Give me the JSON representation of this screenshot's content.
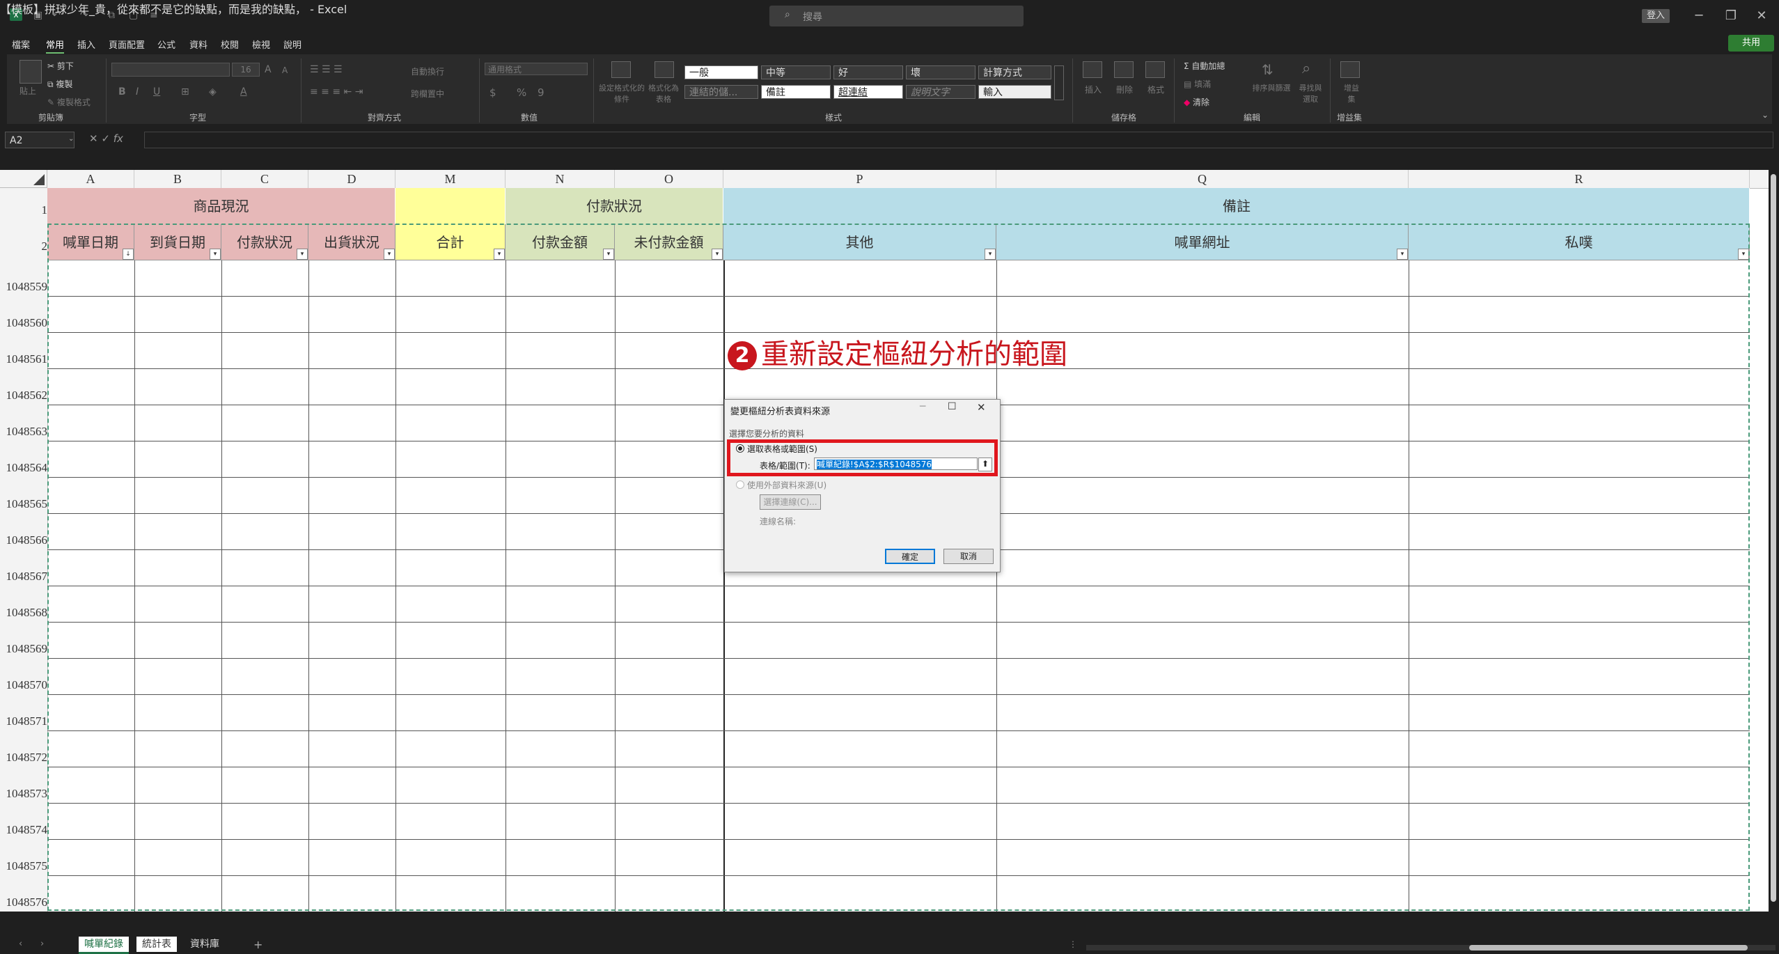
{
  "window": {
    "title": "【模板】拼球少年_貴，從來都不是它的缺點，而是我的缺點， - Excel",
    "search_placeholder": "搜尋",
    "signin": "登入",
    "minimize": "─",
    "restore": "❐",
    "close": "✕"
  },
  "menu": {
    "tabs": [
      "檔案",
      "常用",
      "插入",
      "頁面配置",
      "公式",
      "資料",
      "校閱",
      "檢視",
      "說明"
    ],
    "share": "共用"
  },
  "ribbon": {
    "clipboard": {
      "paste": "貼上",
      "cut": "剪下",
      "copy": "複製",
      "format_painter": "複製格式",
      "label": "剪貼簿"
    },
    "font": {
      "label": "字型",
      "size": "16",
      "bold": "B",
      "italic": "I",
      "underline": "U",
      "grow": "A",
      "shrink": "A"
    },
    "alignment": {
      "wrap": "自動換行",
      "merge": "跨欄置中",
      "label": "對齊方式"
    },
    "number": {
      "format": "通用格式",
      "currency": "$",
      "percent": "%",
      "comma": "9",
      "label": "數值"
    },
    "styles": {
      "conditional": "設定格式化的條件",
      "format_table": "格式化為表格",
      "cells": [
        "一般",
        "中等",
        "好",
        "壞",
        "計算方式",
        "連結的儲...",
        "備註",
        "超連結",
        "說明文字",
        "輸入"
      ],
      "label": "樣式"
    },
    "cells_group": {
      "insert": "插入",
      "delete": "刪除",
      "format": "格式",
      "label": "儲存格"
    },
    "editing": {
      "autosum": "自動加總",
      "fill": "填滿",
      "clear": "清除",
      "sort": "排序與篩選",
      "find": "尋找與選取",
      "label": "編輯"
    },
    "addins": {
      "addins": "增益集",
      "label": "增益集"
    }
  },
  "formula_bar": {
    "name_box": "A2",
    "fx": "fx"
  },
  "sheet": {
    "columns": [
      "A",
      "B",
      "C",
      "D",
      "M",
      "N",
      "O",
      "P",
      "Q",
      "R"
    ],
    "row1_headers": [
      "1",
      "2"
    ],
    "header_row1": [
      "商品現況",
      "付款狀況",
      "備註"
    ],
    "header_row2": [
      "喊單日期",
      "到貨日期",
      "付款狀況",
      "出貨狀況",
      "合計",
      "付款金額",
      "未付款金額",
      "其他",
      "喊單網址",
      "私噗"
    ],
    "row_numbers": [
      "1048559",
      "1048560",
      "1048561",
      "1048562",
      "1048563",
      "1048564",
      "1048565",
      "1048566",
      "1048567",
      "1048568",
      "1048569",
      "1048570",
      "1048571",
      "1048572",
      "1048573",
      "1048574",
      "1048575",
      "1048576"
    ],
    "colors": {
      "pink": "#e6b8b8",
      "yellow": "#ffff99",
      "green": "#d8e4bc",
      "blue": "#b7dde8"
    }
  },
  "annotation": {
    "number": "2",
    "text": "重新設定樞紐分析的範圍"
  },
  "dialog": {
    "title": "變更樞紐分析表資料來源",
    "instruction": "選擇您要分析的資料",
    "option_table": "選取表格或範圍(S)",
    "range_label": "表格/範圍(T):",
    "range_value": "喊單紀錄!$A$2:$R$1048576",
    "option_external": "使用外部資料來源(U)",
    "choose_connection": "選擇連線(C)...",
    "connection_name": "連線名稱:",
    "ok": "確定",
    "cancel": "取消"
  },
  "tabs": {
    "sheets": [
      "喊單紀錄",
      "統計表",
      "資料庫"
    ],
    "add": "+"
  }
}
